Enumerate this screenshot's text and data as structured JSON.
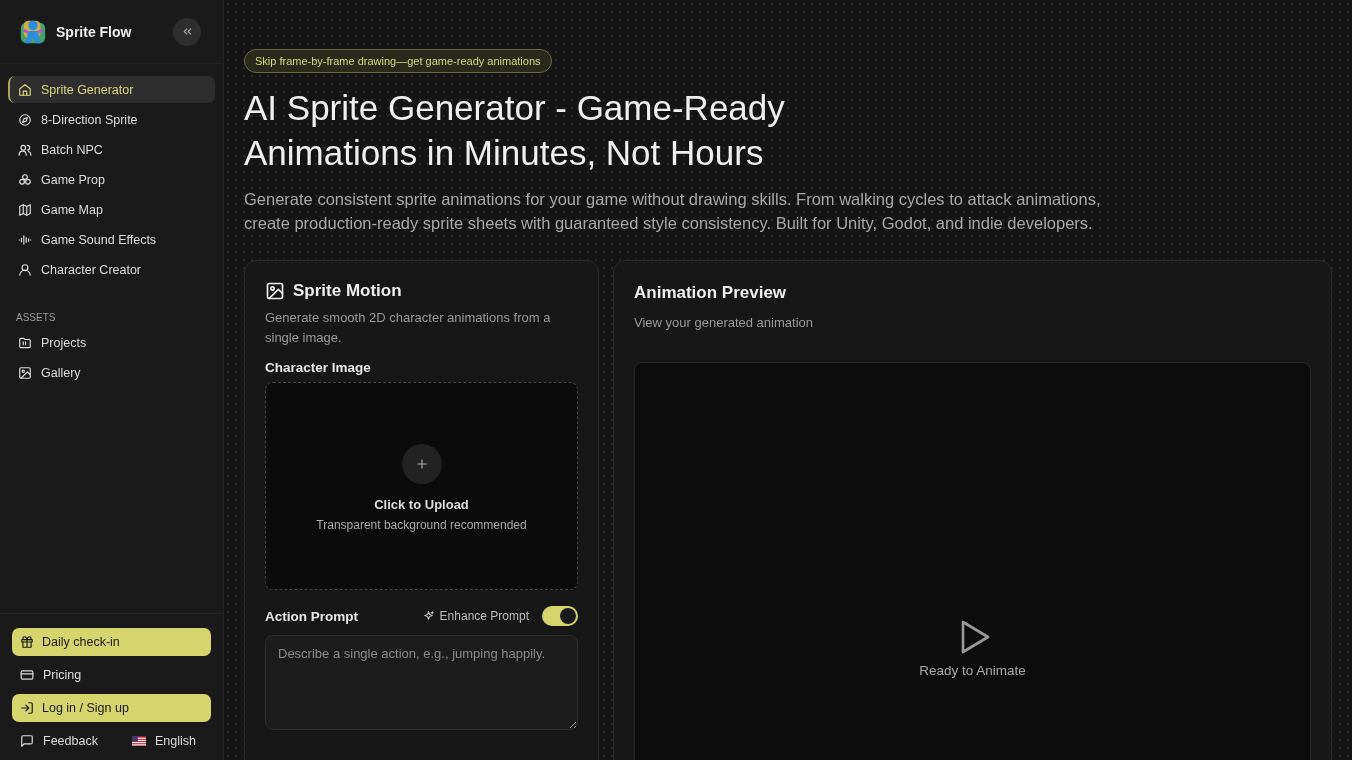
{
  "app": {
    "name": "Sprite Flow"
  },
  "nav": [
    {
      "label": "Sprite Generator",
      "selected": true
    },
    {
      "label": "8-Direction Sprite",
      "selected": false
    },
    {
      "label": "Batch NPC",
      "selected": false
    },
    {
      "label": "Game Prop",
      "selected": false
    },
    {
      "label": "Game Map",
      "selected": false
    },
    {
      "label": "Game Sound Effects",
      "selected": false
    },
    {
      "label": "Character Creator",
      "selected": false
    }
  ],
  "assets": {
    "heading": "ASSETS",
    "items": [
      {
        "label": "Projects",
        "selected": false
      },
      {
        "label": "Gallery",
        "selected": false
      }
    ]
  },
  "footer": {
    "daily_checkin": "Daily check-in",
    "pricing": "Pricing",
    "login": "Log in / Sign up",
    "feedback": "Feedback",
    "language": "English"
  },
  "hero": {
    "badge": "Skip frame-by-frame drawing—get game-ready animations",
    "title": [
      "AI Sprite Generator - Game-Ready",
      "Animations in Minutes, Not Hours"
    ],
    "subtitle": "Generate consistent sprite animations for your game without drawing skills. From walking cycles to attack animations, create production-ready sprite sheets with guaranteed style consistency. Built for Unity, Godot, and indie developers."
  },
  "motion_card": {
    "title": "Sprite Motion",
    "description": "Generate smooth 2D character animations from a single image.",
    "image_label": "Character Image",
    "upload": {
      "title": "Click to Upload",
      "hint": "Transparent background recommended"
    },
    "prompt_label": "Action Prompt",
    "enhance": {
      "label": "Enhance Prompt",
      "on": true
    },
    "prompt": {
      "placeholder": "Describe a single action, e.g., jumping happily."
    }
  },
  "preview_card": {
    "title": "Animation Preview",
    "description": "View your generated animation",
    "status": "Ready to Animate"
  }
}
